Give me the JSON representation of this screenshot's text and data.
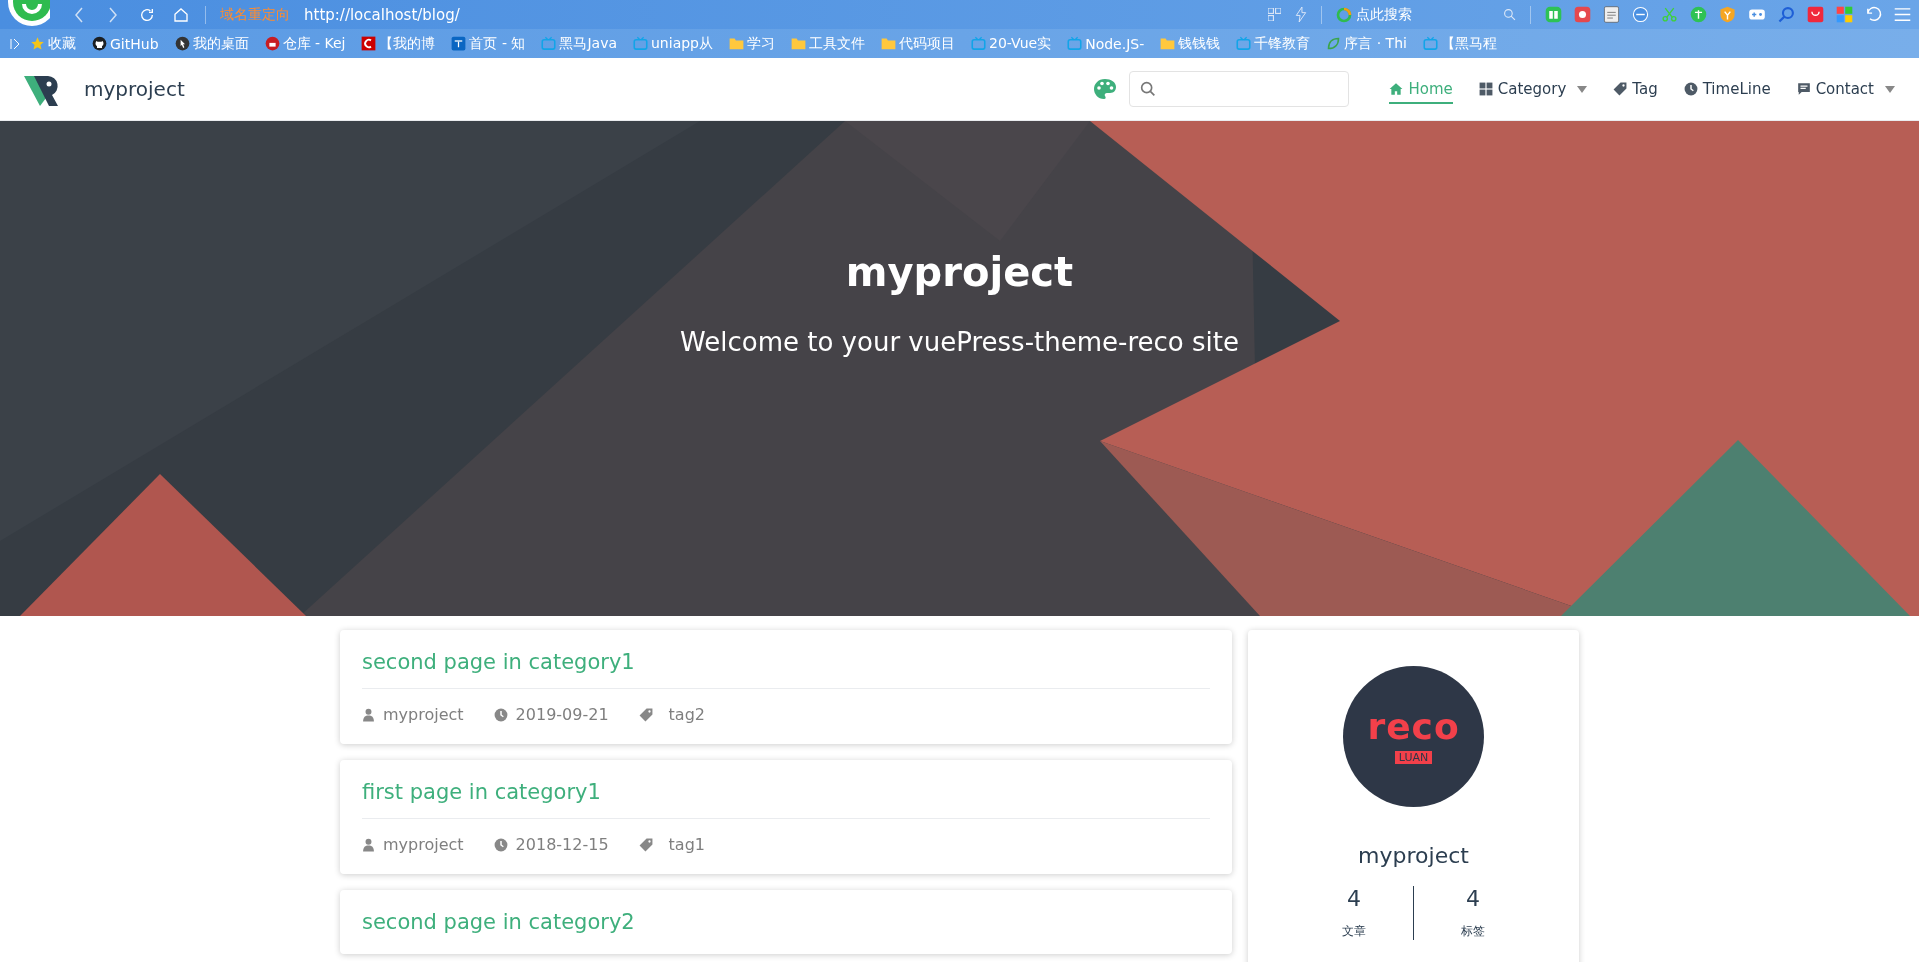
{
  "browser": {
    "redirect_label": "域名重定向",
    "url": "http://localhost/blog/",
    "search_placeholder": "点此搜索",
    "bookmarks": [
      {
        "label": "收藏",
        "kind": "star"
      },
      {
        "label": "GitHub",
        "kind": "github"
      },
      {
        "label": "我的桌面",
        "kind": "site"
      },
      {
        "label": "仓库 - Kej",
        "kind": "gitee"
      },
      {
        "label": "【我的博",
        "kind": "csdn"
      },
      {
        "label": "首页 - 知",
        "kind": "zhihu"
      },
      {
        "label": "黑马Java",
        "kind": "tv"
      },
      {
        "label": "uniapp从",
        "kind": "tv"
      },
      {
        "label": "学习",
        "kind": "folder"
      },
      {
        "label": "工具文件",
        "kind": "folder"
      },
      {
        "label": "代码项目",
        "kind": "folder"
      },
      {
        "label": "20-Vue实",
        "kind": "tv"
      },
      {
        "label": "Node.JS-",
        "kind": "tv"
      },
      {
        "label": "钱钱钱",
        "kind": "folder"
      },
      {
        "label": "千锋教育",
        "kind": "tv"
      },
      {
        "label": "序言 · Thi",
        "kind": "leaf"
      },
      {
        "label": "【黑马程",
        "kind": "tv"
      }
    ]
  },
  "navbar": {
    "site_title": "myproject",
    "items": [
      {
        "label": "Home",
        "kind": "home",
        "dropdown": false,
        "selected": true
      },
      {
        "label": "Category",
        "kind": "grid",
        "dropdown": true,
        "selected": false
      },
      {
        "label": "Tag",
        "kind": "tag",
        "dropdown": false,
        "selected": false
      },
      {
        "label": "TimeLine",
        "kind": "clock",
        "dropdown": false,
        "selected": false
      },
      {
        "label": "Contact",
        "kind": "chat",
        "dropdown": true,
        "selected": false
      }
    ]
  },
  "hero": {
    "title": "myproject",
    "subtitle": "Welcome to your vuePress-theme-reco site"
  },
  "posts": [
    {
      "title": "second page in category1",
      "author": "myproject",
      "date": "2019-09-21",
      "tag": "tag2"
    },
    {
      "title": "first page in category1",
      "author": "myproject",
      "date": "2018-12-15",
      "tag": "tag1"
    },
    {
      "title": "second page in category2"
    }
  ],
  "profile": {
    "avatar_text": "reco",
    "avatar_badge": "LUAN",
    "name": "myproject",
    "stats": [
      {
        "value": "4",
        "label": "文章"
      },
      {
        "value": "4",
        "label": "标签"
      }
    ]
  }
}
